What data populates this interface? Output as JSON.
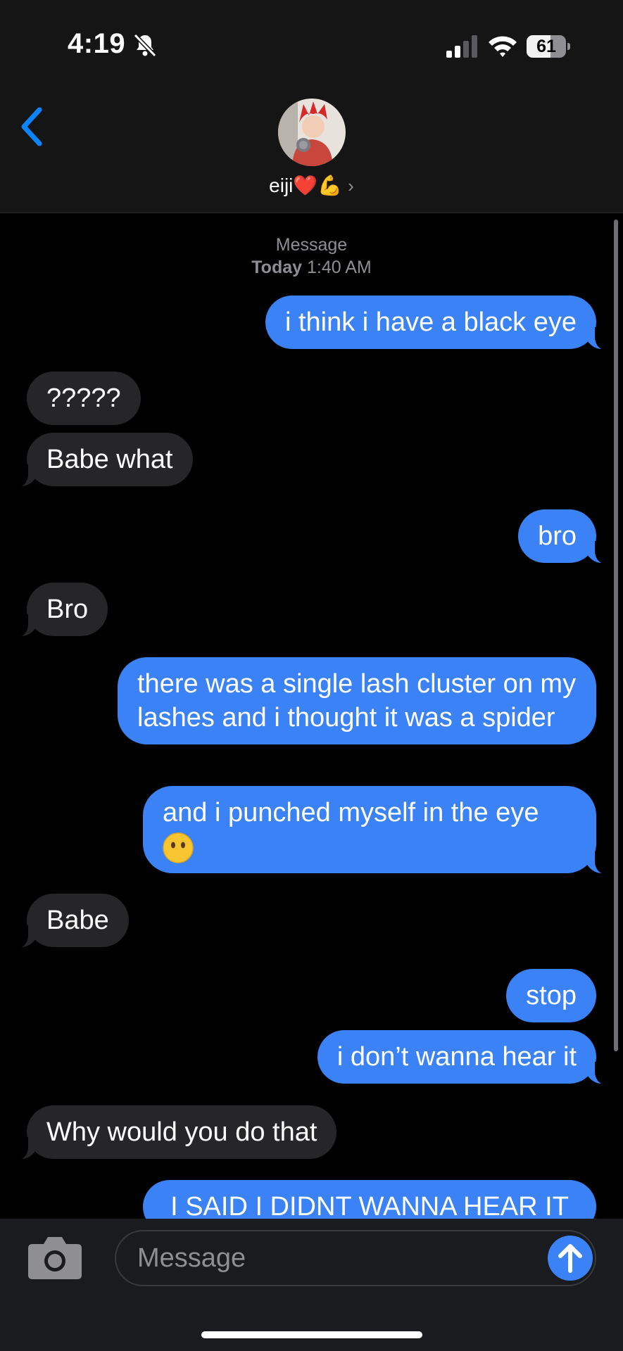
{
  "status_bar": {
    "time": "4:19",
    "battery": "61",
    "battery_level": 0.61
  },
  "header": {
    "contact_name": "eiji❤️💪",
    "chevron": "›"
  },
  "conversation": {
    "service": "Message",
    "day": "Today",
    "time": "1:40 AM",
    "messages": [
      {
        "from": "me",
        "text": "i think i have a black eye"
      },
      {
        "from": "them",
        "text": "?????"
      },
      {
        "from": "them",
        "text": "Babe what"
      },
      {
        "from": "me",
        "text": "bro"
      },
      {
        "from": "them",
        "text": "Bro"
      },
      {
        "from": "me",
        "text": "there was a single lash cluster on my lashes and i thought it was a spider"
      },
      {
        "from": "me",
        "text": "and i punched myself in the eye"
      },
      {
        "from": "them",
        "text": "Babe"
      },
      {
        "from": "me",
        "text": "stop"
      },
      {
        "from": "me",
        "text": "i don’t wanna hear it"
      },
      {
        "from": "them",
        "text": "Why would you do that"
      },
      {
        "from": "me",
        "text": "I SAID I DIDNT WANNA HEAR IT"
      }
    ]
  },
  "input": {
    "placeholder": "Message",
    "value": ""
  },
  "icons": [
    "bell-slash-icon",
    "signal-icon",
    "wifi-icon",
    "battery-icon",
    "back-chevron-icon",
    "camera-icon",
    "send-arrow-icon",
    "no-mouth-face-emoji"
  ],
  "colors": {
    "sent_bubble": "#3b82f6",
    "received_bubble": "#262628",
    "accent": "#0a84ff",
    "background": "#000000"
  }
}
